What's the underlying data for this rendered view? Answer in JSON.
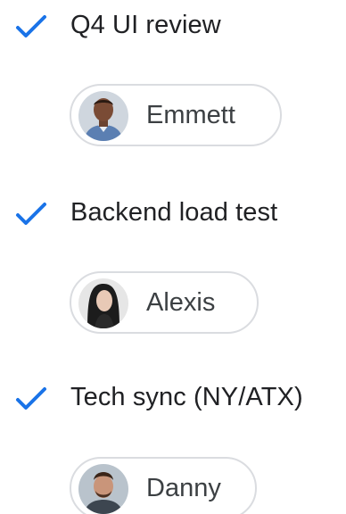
{
  "accent_color": "#1a73e8",
  "tasks": [
    {
      "title": "Q4 UI review",
      "done": true,
      "icon": "checkmark-icon",
      "assignee": {
        "name": "Emmett",
        "avatar": "avatar-emmett"
      }
    },
    {
      "title": "Backend load test",
      "done": true,
      "icon": "checkmark-icon",
      "assignee": {
        "name": "Alexis",
        "avatar": "avatar-alexis"
      }
    },
    {
      "title": "Tech sync (NY/ATX)",
      "done": true,
      "icon": "checkmark-icon",
      "assignee": {
        "name": "Danny",
        "avatar": "avatar-danny"
      }
    }
  ]
}
